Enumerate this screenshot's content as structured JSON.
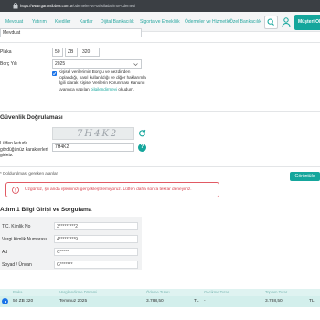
{
  "browser": {
    "url_host": "https://www.garantibbva.com.tr",
    "url_path": "/odemeler-ve-tahsilatlar/mtv-odemesi"
  },
  "nav": {
    "items": [
      "Mevduat",
      "Yatırım",
      "Krediler",
      "Kartlar",
      "Dijital Bankacılık",
      "Sigorta ve Emeklilik",
      "Ödemeler ve Hizmetler",
      "Özel Bankacılık"
    ],
    "cta_label": "Müşteri Ol"
  },
  "form": {
    "field_top_value": "Mevduat",
    "plate_label": "Plaka",
    "plate_parts": [
      "50",
      "ZB",
      "320"
    ],
    "year_label": "Borç Yılı",
    "year_value": "2025",
    "consent_text_prefix": "Kişisel verilerimin Borçlu ve nezdinden toplandığı, nasıl kullanıldığı ve diğer haklarımla ilgili olarak Kişisel Verilerin Korunması Kanunu uyarınca yapılan ",
    "consent_link": "bilgilendirmeyi",
    "consent_text_suffix": " okudum.",
    "consent_checked": true
  },
  "verification": {
    "title": "Güvenlik Doğrulaması",
    "captcha_image_text": "7H4K2",
    "captcha_label": "Lütfen kutuda gördüğünüz karakterleri giriniz.",
    "captcha_input_value": "7H4K2",
    "required_note": "* Doldurulması gereken alanlar",
    "submit_label": "Görüntüle"
  },
  "alert": {
    "message": "Üzgünüz, şu anda işleminizi gerçekleştiremiyoruz. Lütfen daha sonra tekrar deneyiniz.",
    "color": "#d9434f"
  },
  "owner": {
    "title": "Adım 1 Bilgi Girişi ve Sorgulama",
    "fields": [
      {
        "label": "T.C. Kimlik No",
        "value": "3*********2"
      },
      {
        "label": "Vergi Kimlik Numarası",
        "value": "4*********9"
      },
      {
        "label": "Ad",
        "value": "C*****"
      },
      {
        "label": "Soyad / Ünvan",
        "value": "G*******"
      }
    ]
  },
  "table": {
    "headers": [
      "Plaka",
      "Vergilendirme Dönemi",
      "Ödeme Tutarı",
      "Gecikme Tutarı",
      "Toplam Tutar"
    ],
    "rows": [
      {
        "plate": "50 ZB 320",
        "period": "Temmuz 2025",
        "amount": "3.788,50",
        "amount_cur": "TL",
        "delay": "-",
        "total": "3.788,50",
        "total_cur": "TL"
      }
    ]
  },
  "colors": {
    "accent": "#15a69c",
    "nav_text": "#29a7a0",
    "error": "#d9434f"
  }
}
